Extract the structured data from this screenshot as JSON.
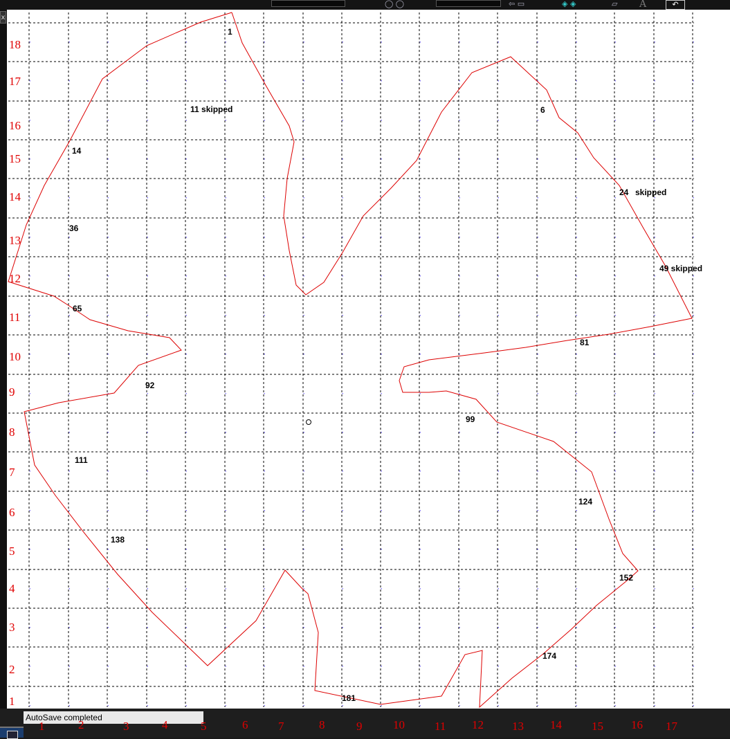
{
  "status": {
    "message": "AutoSave completed"
  },
  "toolbar": {
    "close_glyph": "x",
    "letter_a": "A",
    "icon_names": [
      "layer-icon",
      "shape-icon",
      "stack-icon",
      "text-icon"
    ]
  },
  "colors": {
    "outline": "#dd0000",
    "grid": "#000000",
    "axis_labels": "#e00000",
    "point_labels": "#000000"
  },
  "axes": {
    "x_labels": [
      "1",
      "2",
      "3",
      "4",
      "5",
      "6",
      "7",
      "8",
      "9",
      "10",
      "11",
      "12",
      "13",
      "14",
      "15",
      "16",
      "17"
    ],
    "y_labels": [
      "18",
      "17",
      "16",
      "15",
      "14",
      "13",
      "12",
      "11",
      "10",
      "9",
      "8",
      "7",
      "6",
      "5",
      "4",
      "3",
      "2",
      "1"
    ]
  },
  "point_labels": [
    {
      "text": "1"
    },
    {
      "text": "11 skipped"
    },
    {
      "text": "6"
    },
    {
      "text": "14"
    },
    {
      "text": "24"
    },
    {
      "text": "skipped"
    },
    {
      "text": "36"
    },
    {
      "text": "49 skipped"
    },
    {
      "text": "65"
    },
    {
      "text": "81"
    },
    {
      "text": "92"
    },
    {
      "text": "99"
    },
    {
      "text": "111"
    },
    {
      "text": "124"
    },
    {
      "text": "138"
    },
    {
      "text": "152"
    },
    {
      "text": "174"
    },
    {
      "text": "181"
    }
  ]
}
